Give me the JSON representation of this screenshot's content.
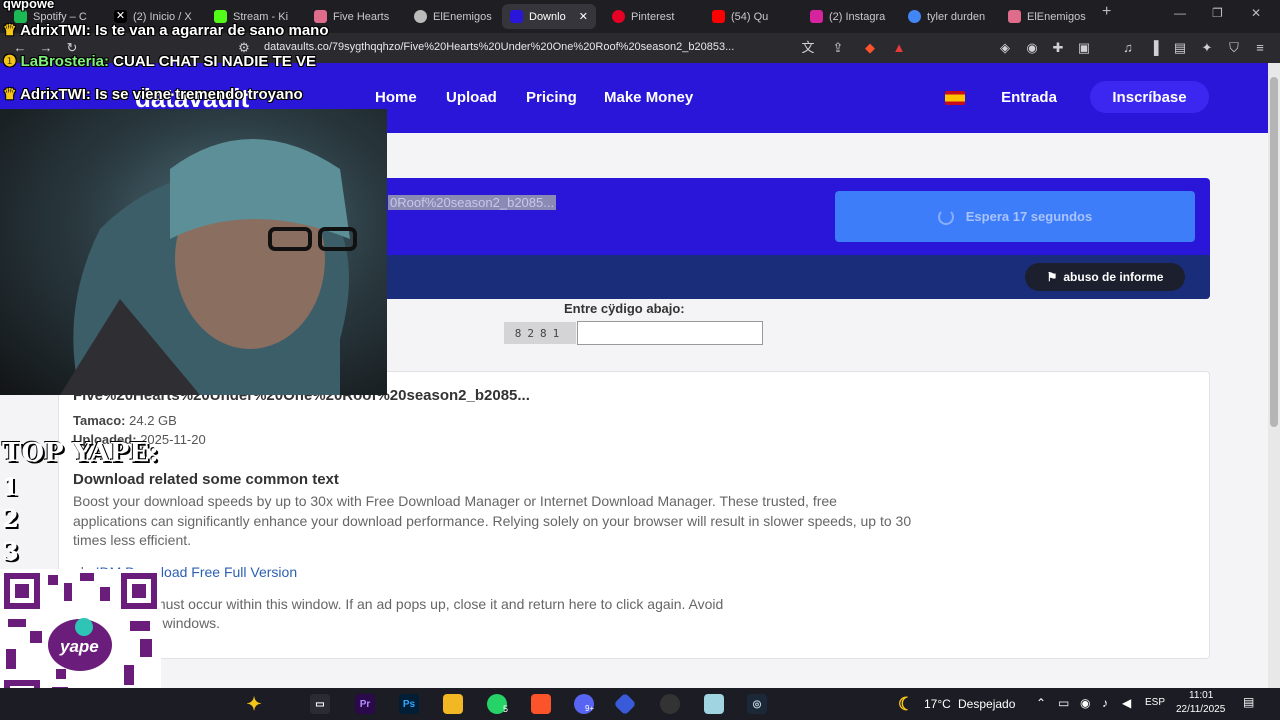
{
  "browser": {
    "tabs": [
      {
        "label": "Spotify – C",
        "color": "#1db954"
      },
      {
        "label": "(2) Inicio / X",
        "color": "#ffffff"
      },
      {
        "label": "Stream - Ki",
        "color": "#53fc18"
      },
      {
        "label": "Five Hearts",
        "color": "#e06c8c"
      },
      {
        "label": "ElEnemigos",
        "color": "#bbbbbb"
      },
      {
        "label": "Downlo",
        "color": "#2a16d9"
      },
      {
        "label": "Pinterest",
        "color": "#e60023"
      },
      {
        "label": "(54) Qu",
        "color": "#ff0000"
      },
      {
        "label": "(2) Instagra",
        "color": "#d6249f"
      },
      {
        "label": "tyler durden",
        "color": "#4285f4"
      },
      {
        "label": "ElEnemigos",
        "color": "#e06c8c"
      }
    ],
    "new_tab": "+",
    "url": "datavaults.co/79sygthqqhzo/Five%20Hearts%20Under%20One%20Roof%20season2_b20853..."
  },
  "site": {
    "logo": "datavault",
    "nav": [
      "Home",
      "Upload",
      "Pricing",
      "Make Money"
    ],
    "login": "Entrada",
    "signup": "Inscríbase",
    "flag": "es-flag"
  },
  "download": {
    "filename_partial": "0Roof%20season2_b2085...",
    "wait_text": "Espera 17 segundos",
    "report": "abuso de informe",
    "code_label": "Entre cÿdigo abajo:",
    "captcha": "8281"
  },
  "file_info": {
    "title": "Five%20Hearts%20Under%20One%20Roof%20season2_b2085...",
    "size_label": "Tamaco:",
    "size_value": "24.2 GB",
    "uploaded_label": "Uploaded:",
    "uploaded_value": "2025-11-20",
    "related_title": "Download related some common text",
    "paragraph1": "Boost your download speeds by up to 30x with Free Download Manager or Internet Download Manager. These trusted, free applications can significantly enhance your download performance. Relying solely on your browser will result in slower speeds, up to 30 times less efficient.",
    "link_prefix": "nk:",
    "link_text": "IDM Download Free Full Version",
    "paragraph2_line1": "ll downloads must occur within this window. If an ad pops up, close it and return here to click again. Avoid",
    "paragraph2_line2": "g from any ad windows."
  },
  "overlay": {
    "top_text": "qwpowe",
    "chat": [
      {
        "user": "AdrixTWI:",
        "msg": "Is te van a agarrar de sano mano",
        "badge": "👑"
      },
      {
        "user": "LaBrosteria:",
        "msg": "CUAL CHAT SI NADIE TE VE",
        "badge": "1"
      },
      {
        "user": "AdrixTWI:",
        "msg": "Is se viene tremendo troyano",
        "badge": "👑"
      }
    ],
    "top_yape": "TOP YAPE:",
    "ranks": [
      "1",
      "2",
      "3"
    ],
    "qr_label": "yape"
  },
  "taskbar": {
    "weather_temp": "17°C",
    "weather_desc": "Despejado",
    "lang": "ESP",
    "time": "11:01",
    "date": "22/11/2025",
    "badge_whatsapp": "5",
    "badge_discord": "9+"
  }
}
